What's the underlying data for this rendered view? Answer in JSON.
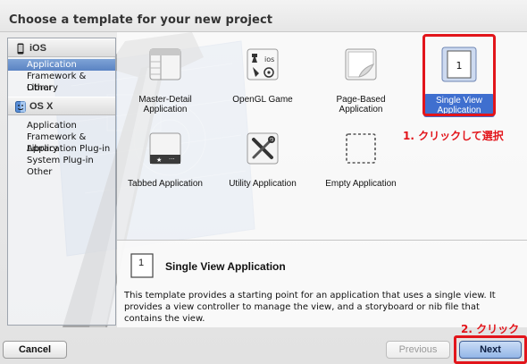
{
  "header": {
    "title": "Choose a template for your new project"
  },
  "sidebar": {
    "groups": [
      {
        "label": "iOS",
        "icon": "iphone-icon",
        "items": [
          "Application",
          "Framework & Library",
          "Other"
        ],
        "selected": 0
      },
      {
        "label": "OS X",
        "icon": "mac-finder-icon",
        "items": [
          "Application",
          "Framework & Library",
          "Application Plug-in",
          "System Plug-in",
          "Other"
        ]
      }
    ]
  },
  "templates": [
    {
      "name": "Master-Detail\nApplication",
      "icon": "master-detail-icon"
    },
    {
      "name": "OpenGL Game",
      "icon": "game-pieces-icon"
    },
    {
      "name": "Page-Based\nApplication",
      "icon": "page-curl-icon"
    },
    {
      "name": "Single View\nApplication",
      "icon": "single-view-icon",
      "selected": true
    },
    {
      "name": "Tabbed Application",
      "icon": "tab-bar-icon"
    },
    {
      "name": "Utility Application",
      "icon": "tools-icon"
    },
    {
      "name": "Empty Application",
      "icon": "empty-dashed-icon"
    }
  ],
  "detail": {
    "number": "1",
    "title": "Single View Application",
    "description": "This template provides a starting point for an application that uses a single view. It provides a view controller to manage the view, and a storyboard or nib file that contains the view."
  },
  "annotations": {
    "step1": "1. クリックして選択",
    "step2": "2. クリック",
    "color": "#e2151b"
  },
  "footer": {
    "cancel": "Cancel",
    "previous": "Previous",
    "next": "Next"
  }
}
